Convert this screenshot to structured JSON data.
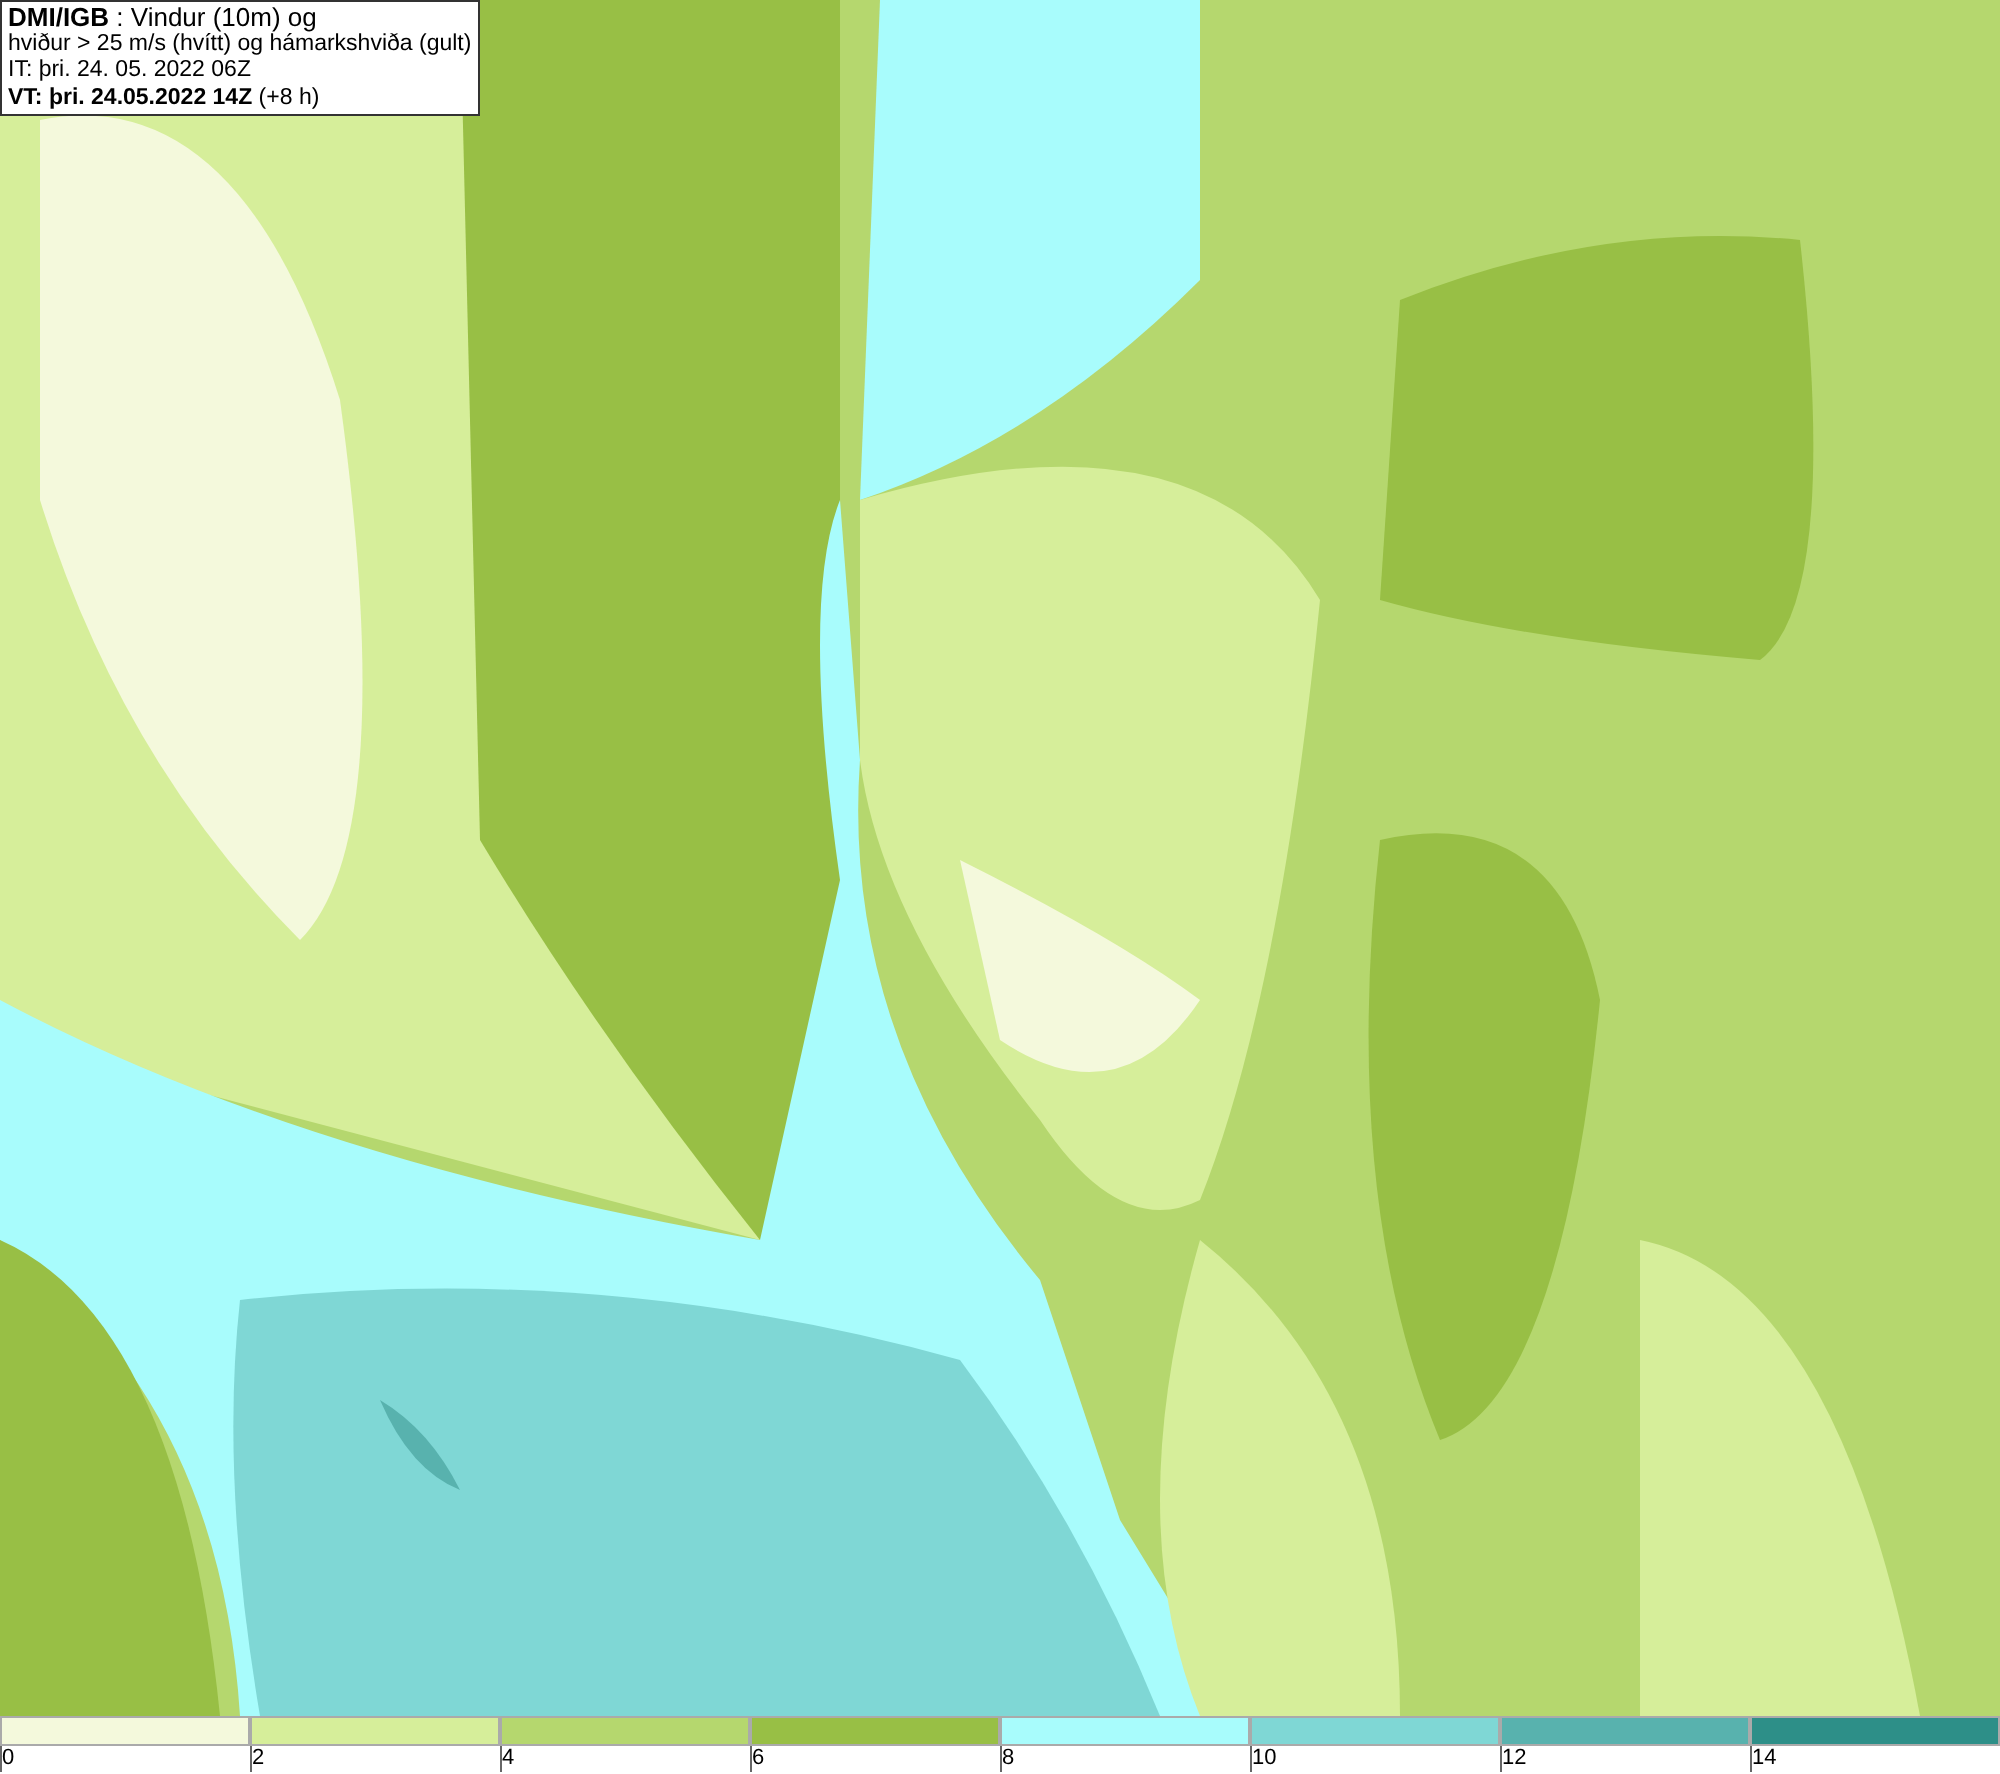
{
  "header": {
    "lines": [
      "**DMI/IGB** : Vindur (10m) og",
      "hviður > 25 m/s (hvítt) og hámarkshviða (gult)",
      "IT: þri. 24. 05. 2022 06Z",
      "**VT: þri. 24.05.2022 14Z** (+8 h)"
    ]
  },
  "legend": [
    {
      "label": "0",
      "color": "#f4f9dc"
    },
    {
      "label": "2",
      "color": "#d6ee9a"
    },
    {
      "label": "4",
      "color": "#b5d76e"
    },
    {
      "label": "6",
      "color": "#98bf45"
    },
    {
      "label": "8",
      "color": "#a8fcfc"
    },
    {
      "label": "10",
      "color": "#7fd7d5"
    },
    {
      "label": "12",
      "color": "#58b2ae"
    },
    {
      "label": "14",
      "color": "#2d8f88"
    }
  ]
}
